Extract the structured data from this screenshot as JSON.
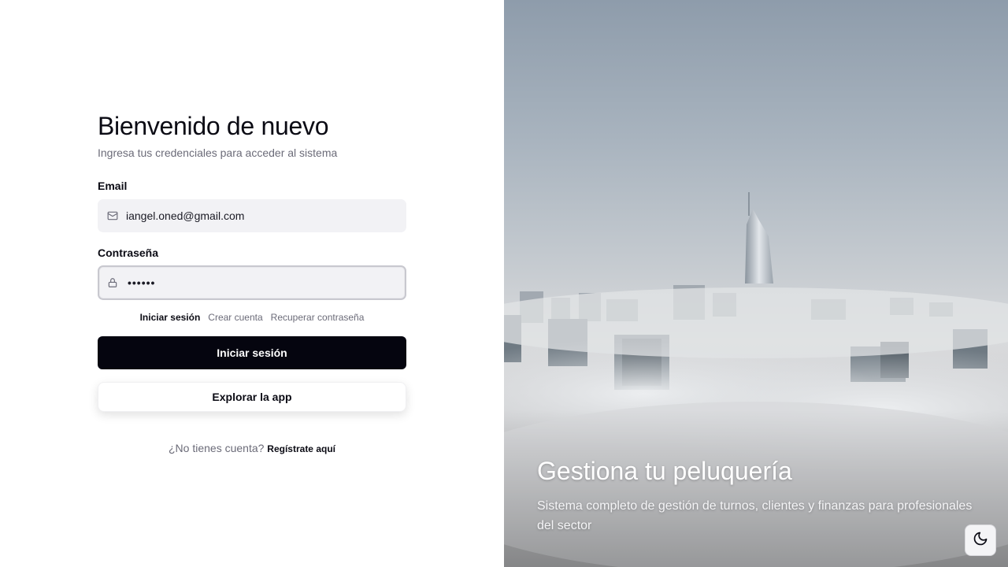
{
  "login": {
    "title": "Bienvenido de nuevo",
    "subtitle": "Ingresa tus credenciales para acceder al sistema",
    "email_label": "Email",
    "email_value": "iangel.oned@gmail.com",
    "password_label": "Contraseña",
    "password_value": "••••••",
    "tabs": [
      "Iniciar sesión",
      "Crear cuenta",
      "Recuperar contraseña"
    ],
    "submit_label": "Iniciar sesión",
    "explore_label": "Explorar la app",
    "register_prompt": "¿No tienes cuenta?",
    "register_link": "Regístrate aquí"
  },
  "hero": {
    "title": "Gestiona tu peluquería",
    "description": "Sistema completo de gestión de turnos, clientes y finanzas para profesionales del sector"
  },
  "icons": {
    "email": "mail-icon",
    "password": "lock-icon",
    "theme": "moon-icon"
  },
  "colors": {
    "primary_button": "#05050f",
    "muted_text": "#6b6b78",
    "input_bg": "#f2f2f5"
  }
}
